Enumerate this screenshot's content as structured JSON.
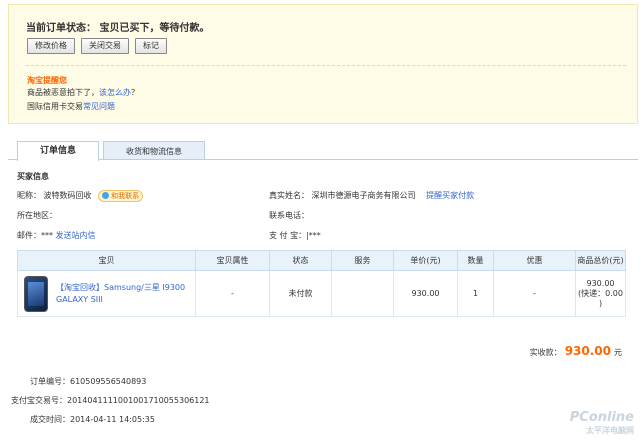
{
  "status": {
    "title": "当前订单状态： 宝贝已买下，等待付款。",
    "buttons": [
      "修改价格",
      "关闭交易",
      "标记"
    ]
  },
  "reminder": {
    "title": "淘宝提醒您",
    "line1_text": "商品被恶意拍下了，",
    "line1_link": "该怎么办",
    "line1_end": "？",
    "line2_text": "国际信用卡交易",
    "line2_link": "常见问题"
  },
  "tabs": [
    "订单信息",
    "收货和物流信息"
  ],
  "buyer": {
    "section_title": "买家信息",
    "nickname_label": "昵称：",
    "nickname": "波特数码回收",
    "wangwang": "和我联系",
    "realname_label": "真实姓名：",
    "realname": "深圳市德源电子商务有限公司",
    "remind_pay": "提醒买家付款",
    "region_label": "所在地区：",
    "region": "",
    "phone_label": "联系电话：",
    "phone": "",
    "email_label": "邮件：",
    "email": "***",
    "email_link": "发送站内信",
    "alipay_label": "支 付 宝：",
    "alipay": "|***"
  },
  "table": {
    "headers": [
      "宝贝",
      "宝贝属性",
      "状态",
      "服务",
      "单价(元)",
      "数量",
      "优惠",
      "商品总价(元)"
    ],
    "row": {
      "name": "【淘宝回收】Samsung/三星 I9300 GALAXY SIII",
      "attr": "-",
      "state": "未付款",
      "service": "",
      "price": "930.00",
      "qty": "1",
      "discount": "-",
      "total": "930.00",
      "shipping": "(快递：0.00 )"
    }
  },
  "summary": {
    "label": "实收款：",
    "amount": "930.00",
    "unit": "元"
  },
  "meta": {
    "order_no_label": "订单编号：",
    "order_no": "610509556540893",
    "alipay_no_label": "支付宝交易号：",
    "alipay_no": "2014041111001001710055306121",
    "time_label": "成交时间：",
    "time": "2014-04-11 14:05:35"
  },
  "watermark": {
    "brand": "PConline",
    "sub": "太平洋电脑网"
  }
}
